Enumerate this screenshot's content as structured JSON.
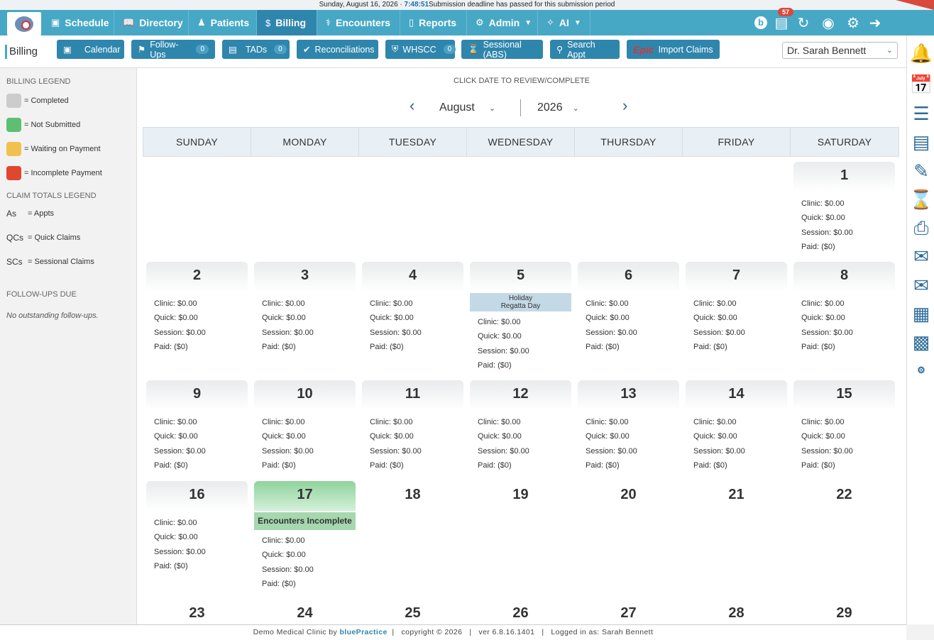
{
  "status_bar": {
    "date": "Sunday, August 16, 2026 · ",
    "time": "7:48:51",
    "message": "Submission deadline has passed for this submission period"
  },
  "nav": {
    "tabs": [
      {
        "label": "Schedule",
        "icon": "calendar-icon"
      },
      {
        "label": "Directory",
        "icon": "book-icon"
      },
      {
        "label": "Patients",
        "icon": "users-icon"
      },
      {
        "label": "Billing",
        "icon": "dollar-icon",
        "active": true
      },
      {
        "label": "Encounters",
        "icon": "stethoscope-icon"
      },
      {
        "label": "Reports",
        "icon": "bar-chart-icon"
      },
      {
        "label": "Admin",
        "icon": "gear-icon"
      },
      {
        "label": "AI",
        "icon": "sparkle-icon"
      }
    ],
    "notification_count": "57"
  },
  "toolbar": {
    "title": "Billing",
    "buttons": {
      "calendar": "Calendar",
      "follow_ups": "Follow-Ups",
      "follow_ups_count": "0",
      "tads": "TADs",
      "tads_count": "0",
      "reconciliations": "Reconciliations",
      "whscc": "WHSCC",
      "whscc_count": "0",
      "sessional": "Sessional (ABS)",
      "search_appt": "Search Appt",
      "epic": "Epic",
      "import_claims": "Import Claims"
    },
    "provider": "Dr. Sarah Bennett"
  },
  "sidebar": {
    "billing_legend_title": "BILLING LEGEND",
    "billing_legend": [
      {
        "label": "= Completed",
        "color": "#cccccc"
      },
      {
        "label": "= Not Submitted",
        "color": "#5cbf73"
      },
      {
        "label": "= Waiting on Payment",
        "color": "#f0c14f"
      },
      {
        "label": "= Incomplete Payment",
        "color": "#e0472f"
      }
    ],
    "claim_legend_title": "CLAIM TOTALS LEGEND",
    "claim_legend": [
      {
        "abbr": "As",
        "label": "= Appts"
      },
      {
        "abbr": "QCs",
        "label": "= Quick Claims"
      },
      {
        "abbr": "SCs",
        "label": "= Sessional Claims"
      }
    ],
    "followups_title": "FOLLOW-UPS DUE",
    "followups_empty": "No outstanding follow-ups."
  },
  "calendar": {
    "hint": "CLICK DATE TO REVIEW/COMPLETE",
    "month": "August",
    "year": "2026",
    "weekdays": [
      "SUNDAY",
      "MONDAY",
      "TUESDAY",
      "WEDNESDAY",
      "THURSDAY",
      "FRIDAY",
      "SATURDAY"
    ],
    "amount_labels": {
      "clinic": "Clinic: $0.00",
      "quick": "Quick: $0.00",
      "session": "Session: $0.00",
      "paid": "Paid: ($0)"
    },
    "holiday": {
      "title": "Holiday",
      "name": "Regatta Day"
    },
    "encounters_incomplete": "Encounters Incomplete",
    "days": [
      "1",
      "2",
      "3",
      "4",
      "5",
      "6",
      "7",
      "8",
      "9",
      "10",
      "11",
      "12",
      "13",
      "14",
      "15",
      "16",
      "17",
      "18",
      "19",
      "20",
      "21",
      "22",
      "23",
      "24",
      "25",
      "26",
      "27",
      "28",
      "29"
    ]
  },
  "footer": {
    "clinic": "Demo Medical Clinic by ",
    "brand": "bluePractice",
    "rest": "  |   copyright © 2026   |   ver 6.8.16.1401   |   Logged in as: Sarah Bennett"
  }
}
